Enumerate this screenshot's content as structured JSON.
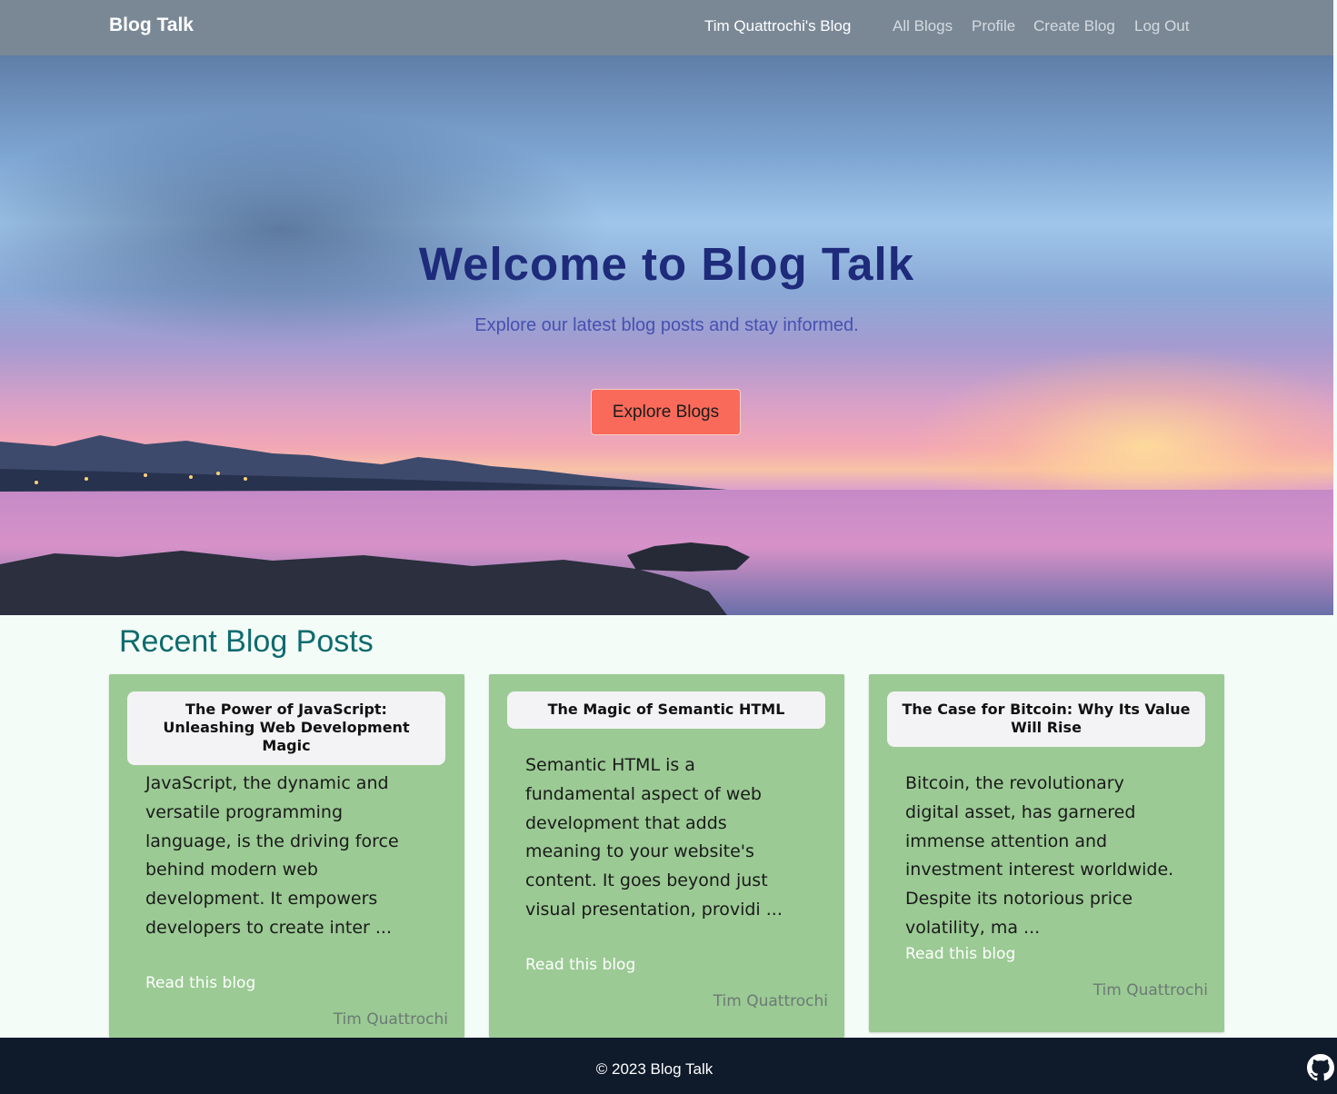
{
  "navbar": {
    "brand": "Blog Talk",
    "user_blog": "Tim Quattrochi's Blog",
    "links": [
      "All Blogs",
      "Profile",
      "Create Blog",
      "Log Out"
    ]
  },
  "hero": {
    "title": "Welcome to Blog Talk",
    "subtitle": "Explore our latest blog posts and stay informed.",
    "button": "Explore Blogs"
  },
  "recent": {
    "heading": "Recent Blog Posts",
    "posts": [
      {
        "title": "The Power of JavaScript: Unleashing Web Development Magic",
        "excerpt": "JavaScript, the dynamic and versatile programming language, is the driving force behind modern web development. It empowers developers to create inter ...",
        "link": "Read this blog",
        "author": "Tim Quattrochi"
      },
      {
        "title": "The Magic of Semantic HTML",
        "excerpt": "Semantic HTML is a fundamental aspect of web development that adds meaning to your website's content. It goes beyond just visual presentation, providi ...",
        "link": "Read this blog",
        "author": "Tim Quattrochi"
      },
      {
        "title": "The Case for Bitcoin: Why Its Value Will Rise",
        "excerpt": "Bitcoin, the revolutionary digital asset, has garnered immense attention and investment interest worldwide. Despite its notorious price volatility, ma ...",
        "link": "Read this blog",
        "author": "Tim Quattrochi"
      }
    ]
  },
  "footer": {
    "copyright": "© 2023 Blog Talk"
  },
  "colors": {
    "navbar": "#7a8896",
    "hero_button": "#fa6a5a",
    "card": "#9bca94",
    "heading": "#0f6b6e",
    "footer": "#0f1a2b"
  },
  "icons": {
    "footer": "github-icon"
  }
}
